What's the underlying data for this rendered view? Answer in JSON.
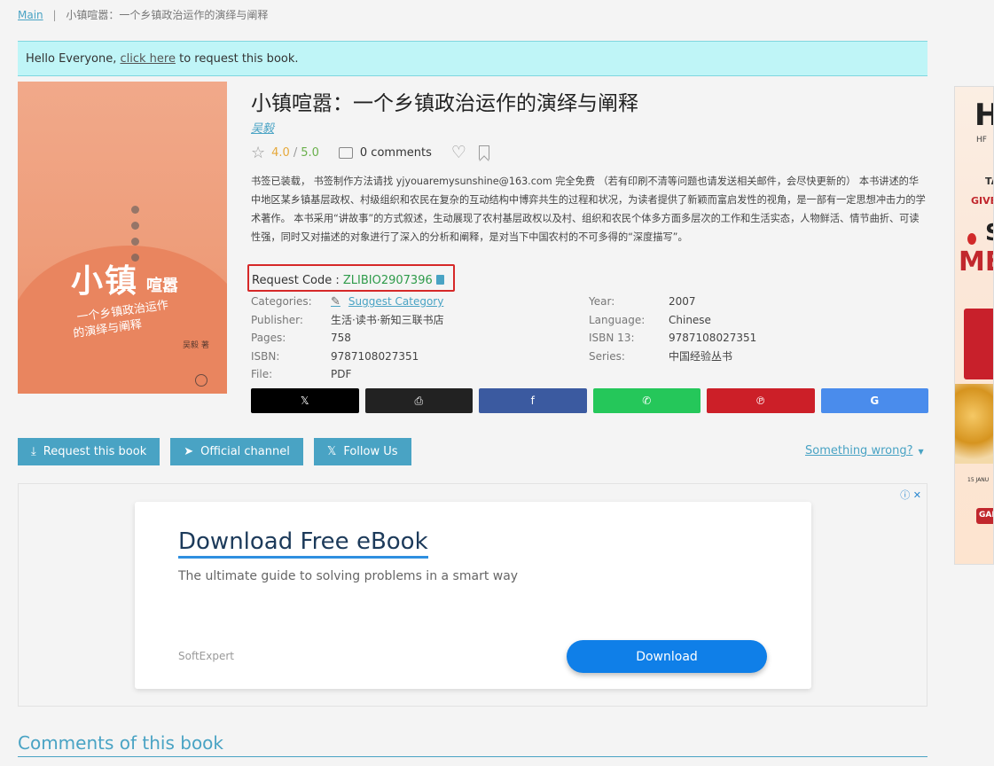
{
  "breadcrumb": {
    "main": "Main",
    "separator": "|",
    "current": "小镇喧嚣：一个乡镇政治运作的演绎与阐释"
  },
  "banner": {
    "prefix": "Hello Everyone, ",
    "link": "click here",
    "suffix": " to request this book."
  },
  "cover": {
    "big_title": "小镇",
    "small_title": "喧嚣",
    "subtitle_line1": "一个乡镇政治运作",
    "subtitle_line2": "的演绎与阐释",
    "author": "吴毅 著"
  },
  "book": {
    "title": "小镇喧嚣：一个乡镇政治运作的演绎与阐释",
    "author": "吴毅",
    "rating": "4.0",
    "rating_sep": "/",
    "rating_max": "5.0",
    "comments": "0 comments",
    "description": "书签已装载， 书签制作方法请找 yjyouaremysunshine@163.com 完全免费 （若有印刷不清等问题也请发送相关邮件，会尽快更新的） 本书讲述的华中地区某乡镇基层政权、村级组织和农民在复杂的互动结构中博弈共生的过程和状况，为读者提供了新颖而富启发性的视角，是一部有一定思想冲击力的学术著作。 本书采用“讲故事”的方式叙述，生动展现了农村基层政权以及村、组织和农民个体多方面多层次的工作和生活实态，人物鲜活、情节曲折、可读性强，同时又对描述的对象进行了深入的分析和阐释，是对当下中国农村的不可多得的“深度描写”。",
    "request_code_label": "Request Code : ",
    "request_code": "ZLIBIO2907396"
  },
  "details_left": [
    {
      "key": "Categories:",
      "value": "Suggest Category"
    },
    {
      "key": "Publisher:",
      "value": "生活·读书·新知三联书店"
    },
    {
      "key": "Pages:",
      "value": "758"
    },
    {
      "key": "ISBN:",
      "value": "9787108027351"
    },
    {
      "key": "File:",
      "value": "PDF"
    }
  ],
  "details_right": [
    {
      "key": "Year:",
      "value": "2007"
    },
    {
      "key": "Language:",
      "value": "Chinese"
    },
    {
      "key": "ISBN 13:",
      "value": "9787108027351"
    },
    {
      "key": "Series:",
      "value": "中国经验丛书"
    }
  ],
  "share": [
    {
      "name": "x",
      "glyph": "𝕏"
    },
    {
      "name": "print",
      "glyph": "⎙"
    },
    {
      "name": "facebook",
      "glyph": "f"
    },
    {
      "name": "whatsapp",
      "glyph": "✆"
    },
    {
      "name": "pinterest",
      "glyph": "℗"
    },
    {
      "name": "google",
      "glyph": "G"
    }
  ],
  "actions": {
    "request": "Request this book",
    "official": "Official channel",
    "follow": "Follow Us",
    "something_wrong": "Something wrong?"
  },
  "ad": {
    "badge": "ⓘ ✕",
    "title": "Download Free eBook",
    "subtitle": "The ultimate guide to solving problems in a smart way",
    "brand": "SoftExpert",
    "button": "Download"
  },
  "comments_title": "Comments of this book",
  "side_ad": {
    "h": "H",
    "hf": "HF",
    "ta": "TA",
    "give": "GIVE",
    "s": "S",
    "me": "ME",
    "date": "15 JANU",
    "gab": "GAB"
  },
  "colors": {
    "accent": "#49a3c4",
    "banner_bg": "#bff5f7",
    "highlight_border": "#d62828",
    "code_green": "#2e9b4a"
  }
}
